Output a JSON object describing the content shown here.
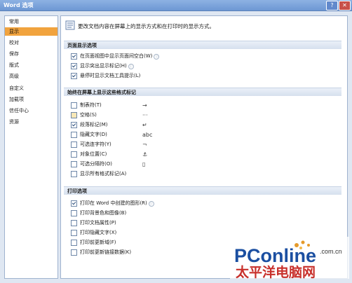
{
  "window": {
    "title": "Word 选项",
    "help_label": "?",
    "close_label": "✕"
  },
  "sidebar": {
    "items": [
      {
        "label": "常用",
        "active": false
      },
      {
        "label": "显示",
        "active": true
      },
      {
        "label": "校对",
        "active": false
      },
      {
        "label": "保存",
        "active": false
      },
      {
        "label": "版式",
        "active": false
      },
      {
        "label": "高级",
        "active": false
      },
      {
        "label": "自定义",
        "active": false
      },
      {
        "label": "加载项",
        "active": false
      },
      {
        "label": "信任中心",
        "active": false
      },
      {
        "label": "资源",
        "active": false
      }
    ]
  },
  "main": {
    "intro": "更改文档内容在屏幕上的显示方式和在打印时的显示方式。",
    "sections": [
      {
        "header": "页面显示选项",
        "options": [
          {
            "label": "在页面视图中显示页面间空白(W)",
            "checked": true,
            "info": "ⓘ"
          },
          {
            "label": "显示突出显示标记(H)",
            "checked": true,
            "info": "ⓘ"
          },
          {
            "label": "悬停时显示文档工具提示(L)",
            "checked": true,
            "info": ""
          }
        ]
      },
      {
        "header": "始终在屏幕上显示这些格式标记",
        "options": [
          {
            "label": "制表符(T)",
            "checked": false,
            "symbol": "→"
          },
          {
            "label": "空格(S)",
            "checked": false,
            "symbol": "···",
            "partial": true
          },
          {
            "label": "段落标记(M)",
            "checked": true,
            "symbol": "↵"
          },
          {
            "label": "隐藏文字(D)",
            "checked": false,
            "symbol": "abc"
          },
          {
            "label": "可选连字符(Y)",
            "checked": false,
            "symbol": "¬"
          },
          {
            "label": "对象位置(C)",
            "checked": false,
            "symbol": "⚓"
          },
          {
            "label": "可选分隔符(O)",
            "checked": false,
            "symbol": "▯"
          },
          {
            "label": "显示所有格式标记(A)",
            "checked": false,
            "symbol": ""
          }
        ]
      },
      {
        "header": "打印选项",
        "options": [
          {
            "label": "打印在 Word 中创建的图形(R)",
            "checked": true,
            "info": "ⓘ"
          },
          {
            "label": "打印背景色和图像(B)",
            "checked": false
          },
          {
            "label": "打印文档属性(P)",
            "checked": false
          },
          {
            "label": "打印隐藏文字(X)",
            "checked": false
          },
          {
            "label": "打印前更新域(F)",
            "checked": false
          },
          {
            "label": "打印前更新链接数据(K)",
            "checked": false
          }
        ]
      }
    ]
  },
  "watermark": {
    "brand": "PConline",
    "domain": ".com.cn",
    "cn": "太平洋电脑网"
  }
}
